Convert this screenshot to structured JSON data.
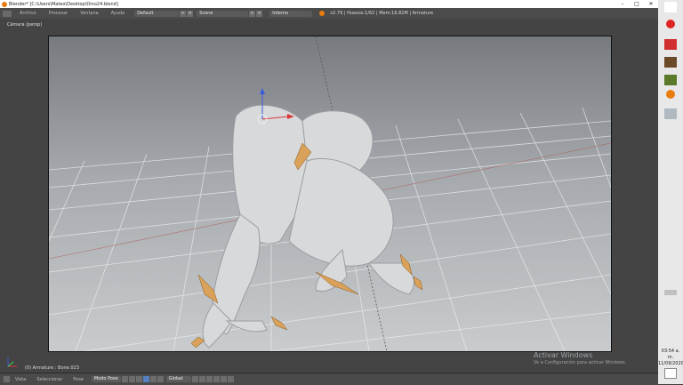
{
  "window": {
    "title": "Blender* [C:\\Users\\Mateo\\Desktop\\Dino24.blend]",
    "buttons": [
      "–",
      "□",
      "✕"
    ]
  },
  "info_header": {
    "menus": [
      "Archivo",
      "Procesar",
      "Ventana",
      "Ayuda"
    ],
    "screen_layout": "Default",
    "scene": "Scene",
    "render_engine": "Interno",
    "stats": "v2.79 | Huesos:1/62 | Mem:16.82M | Armature"
  },
  "viewport": {
    "view_label": "Cámara (persp)",
    "object_label": "(0) Armature : Bone.023"
  },
  "footer": {
    "menus": [
      "Vista",
      "Seleccionar",
      "Pose"
    ],
    "mode": "Modo Pose",
    "orientation": "Global"
  },
  "watermark": {
    "line1": "Activar Windows",
    "line2": "Ve a Configuración para activar Windows."
  },
  "clock": {
    "time": "03:54 a. m.",
    "date": "11/09/2020"
  },
  "colors": {
    "accent": "#e87d0d",
    "selected": "#5680c2",
    "bone": "#d9a15a"
  }
}
